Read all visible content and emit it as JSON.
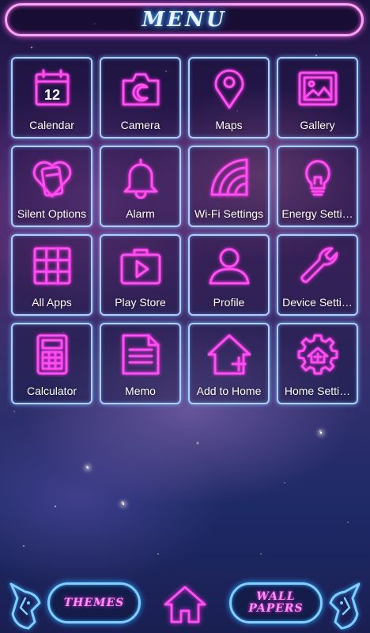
{
  "header": {
    "title": "MENU"
  },
  "apps": [
    {
      "label": "Calendar",
      "icon": "calendar-icon",
      "calendar_day": "12"
    },
    {
      "label": "Camera",
      "icon": "camera-icon"
    },
    {
      "label": "Maps",
      "icon": "map-pin-icon"
    },
    {
      "label": "Gallery",
      "icon": "gallery-icon"
    },
    {
      "label": "Silent Options",
      "icon": "silent-phone-icon"
    },
    {
      "label": "Alarm",
      "icon": "bell-icon"
    },
    {
      "label": "Wi-Fi Settings",
      "icon": "wifi-icon"
    },
    {
      "label": "Energy Setti…",
      "icon": "lightbulb-icon"
    },
    {
      "label": "All Apps",
      "icon": "grid-icon"
    },
    {
      "label": "Play Store",
      "icon": "play-store-icon"
    },
    {
      "label": "Profile",
      "icon": "person-icon"
    },
    {
      "label": "Device Setti…",
      "icon": "wrench-icon"
    },
    {
      "label": "Calculator",
      "icon": "calculator-icon"
    },
    {
      "label": "Memo",
      "icon": "memo-icon"
    },
    {
      "label": "Add to Home",
      "icon": "add-home-icon"
    },
    {
      "label": "Home Setti…",
      "icon": "gear-home-icon"
    }
  ],
  "dock": {
    "themes_label": "THEMES",
    "wallpapers_line1": "WALL",
    "wallpapers_line2": "PAPERS",
    "home_icon": "home-icon"
  },
  "colors": {
    "neon_pink": "#ff4ef2",
    "neon_blue": "#a9d2ff",
    "title_glow": "#4aa8ff"
  }
}
